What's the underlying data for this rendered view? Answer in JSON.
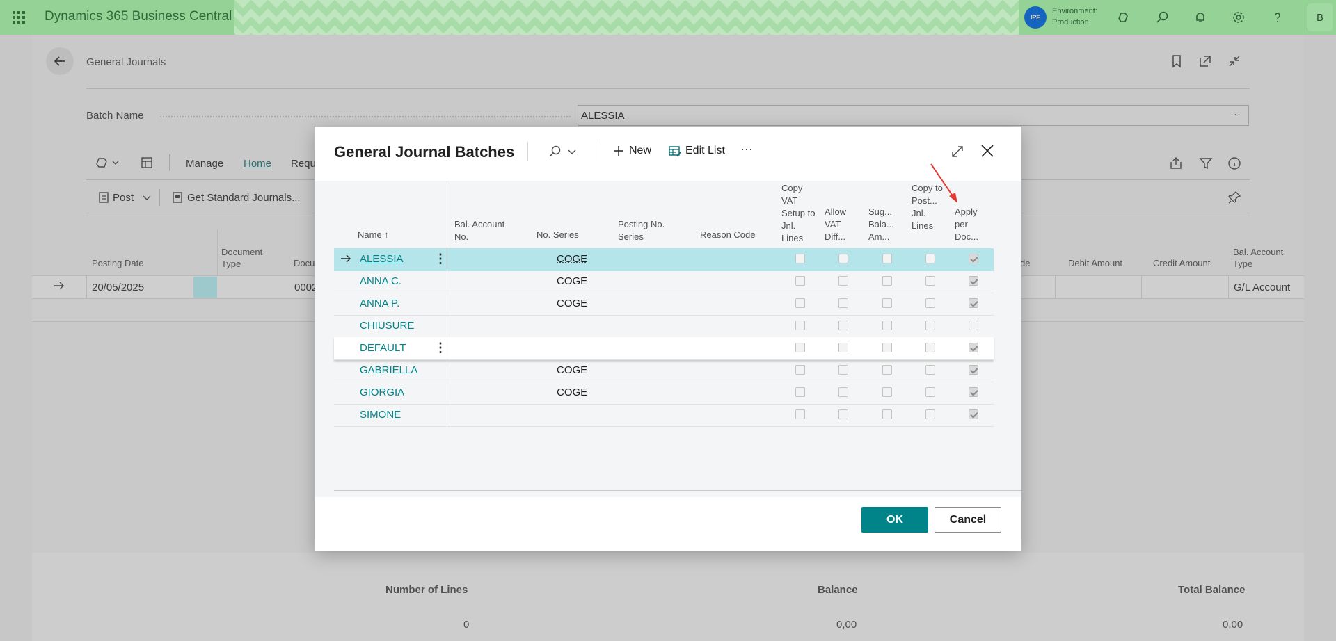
{
  "topbar": {
    "app_name": "Dynamics 365 Business Central",
    "env_initials": "IPE",
    "env_label": "Environment:",
    "env_name": "Production",
    "user_initial": "B"
  },
  "page": {
    "title": "General Journals",
    "batch_label": "Batch Name",
    "batch_value": "ALESSIA",
    "batch_more": "···",
    "tabs": [
      "Manage",
      "Home",
      "Requ"
    ],
    "actions": {
      "post": "Post",
      "get_standard": "Get Standard Journals..."
    },
    "grid_headers": {
      "posting_date": "Posting Date",
      "document_type": "Document Type",
      "docu": "Docu",
      "de": "de",
      "debit_amount": "Debit Amount",
      "credit_amount": "Credit Amount",
      "bal_account_type": "Bal. Account Type"
    },
    "grid_row": {
      "posting_date": "20/05/2025",
      "docu": "0002",
      "bal_account_type": "G/L Account"
    },
    "footer": {
      "number_of_lines_label": "Number of Lines",
      "number_of_lines_value": "0",
      "balance_label": "Balance",
      "balance_value": "0,00",
      "total_balance_label": "Total Balance",
      "total_balance_value": "0,00"
    }
  },
  "modal": {
    "title": "General Journal Batches",
    "new_label": "New",
    "edit_list_label": "Edit List",
    "more_label": "···",
    "ok_label": "OK",
    "cancel_label": "Cancel",
    "headers": {
      "name": "Name ↑",
      "bal_account_no": "Bal. Account No.",
      "no_series": "No. Series",
      "posting_no_series": "Posting No. Series",
      "reason_code": "Reason Code",
      "copy_vat": "Copy VAT Setup to Jnl. Lines",
      "allow_vat": "Allow VAT Diff...",
      "sug_bal": "Sug... Bala... Am...",
      "copy_post": "Copy to Post... Jnl. Lines",
      "apply_per_doc": "Apply per Doc..."
    },
    "rows": [
      {
        "name": "ALESSIA",
        "no_series": "COGE",
        "apply_per_doc": true
      },
      {
        "name": "ANNA C.",
        "no_series": "COGE",
        "apply_per_doc": true
      },
      {
        "name": "ANNA P.",
        "no_series": "COGE",
        "apply_per_doc": true
      },
      {
        "name": "CHIUSURE",
        "no_series": "",
        "apply_per_doc": false
      },
      {
        "name": "DEFAULT",
        "no_series": "",
        "apply_per_doc": true
      },
      {
        "name": "GABRIELLA",
        "no_series": "COGE",
        "apply_per_doc": true
      },
      {
        "name": "GIORGIA",
        "no_series": "COGE",
        "apply_per_doc": true
      },
      {
        "name": "SIMONE",
        "no_series": "",
        "apply_per_doc": true
      }
    ]
  },
  "colors": {
    "accent": "#008489",
    "selected_row": "#b3e5ea",
    "annotation_arrow": "#e53935",
    "topbar": "#a0d9a1"
  }
}
